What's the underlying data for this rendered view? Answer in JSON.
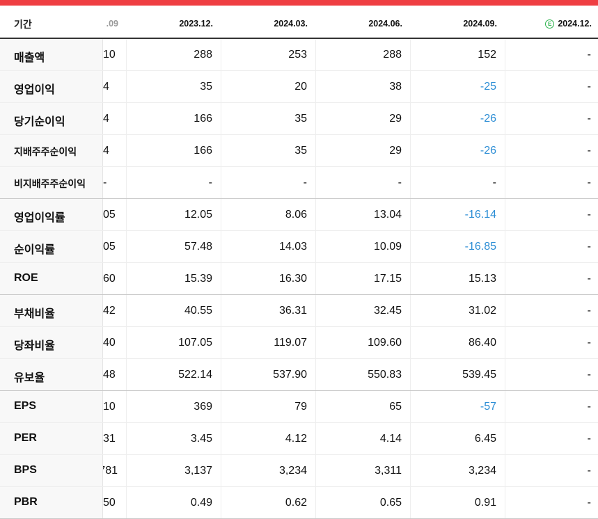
{
  "header": {
    "period_label": "기간",
    "columns": [
      "09.",
      "2023.12.",
      "2024.03.",
      "2024.06.",
      "2024.09.",
      "2024.12."
    ],
    "estimate_badge": "E"
  },
  "colors": {
    "accent_bar": "#ef3e42",
    "negative": "#2d8ed5",
    "estimate": "#2bb24c"
  },
  "rows": [
    {
      "label": "매출액",
      "values": [
        "10",
        "288",
        "253",
        "288",
        "152",
        "-"
      ]
    },
    {
      "label": "영업이익",
      "values": [
        "4",
        "35",
        "20",
        "38",
        "-25",
        "-"
      ]
    },
    {
      "label": "당기순이익",
      "values": [
        "4",
        "166",
        "35",
        "29",
        "-26",
        "-"
      ]
    },
    {
      "label": "지배주주순이익",
      "values": [
        "4",
        "166",
        "35",
        "29",
        "-26",
        "-"
      ]
    },
    {
      "label": "비지배주주순이익",
      "values": [
        "-",
        "-",
        "-",
        "-",
        "-",
        "-"
      ]
    },
    {
      "label": "영업이익률",
      "values": [
        "05",
        "12.05",
        "8.06",
        "13.04",
        "-16.14",
        "-"
      ]
    },
    {
      "label": "순이익률",
      "values": [
        "05",
        "57.48",
        "14.03",
        "10.09",
        "-16.85",
        "-"
      ]
    },
    {
      "label": "ROE",
      "values": [
        "60",
        "15.39",
        "16.30",
        "17.15",
        "15.13",
        "-"
      ]
    },
    {
      "label": "부채비율",
      "values": [
        "42",
        "40.55",
        "36.31",
        "32.45",
        "31.02",
        "-"
      ]
    },
    {
      "label": "당좌비율",
      "values": [
        "40",
        "107.05",
        "119.07",
        "109.60",
        "86.40",
        "-"
      ]
    },
    {
      "label": "유보율",
      "values": [
        "48",
        "522.14",
        "537.90",
        "550.83",
        "539.45",
        "-"
      ]
    },
    {
      "label": "EPS",
      "values": [
        "10",
        "369",
        "79",
        "65",
        "-57",
        "-"
      ]
    },
    {
      "label": "PER",
      "values": [
        "31",
        "3.45",
        "4.12",
        "4.14",
        "6.45",
        "-"
      ]
    },
    {
      "label": "BPS",
      "values": [
        "781",
        "3,137",
        "3,234",
        "3,311",
        "3,234",
        "-"
      ]
    },
    {
      "label": "PBR",
      "values": [
        "50",
        "0.49",
        "0.62",
        "0.65",
        "0.91",
        "-"
      ]
    }
  ]
}
